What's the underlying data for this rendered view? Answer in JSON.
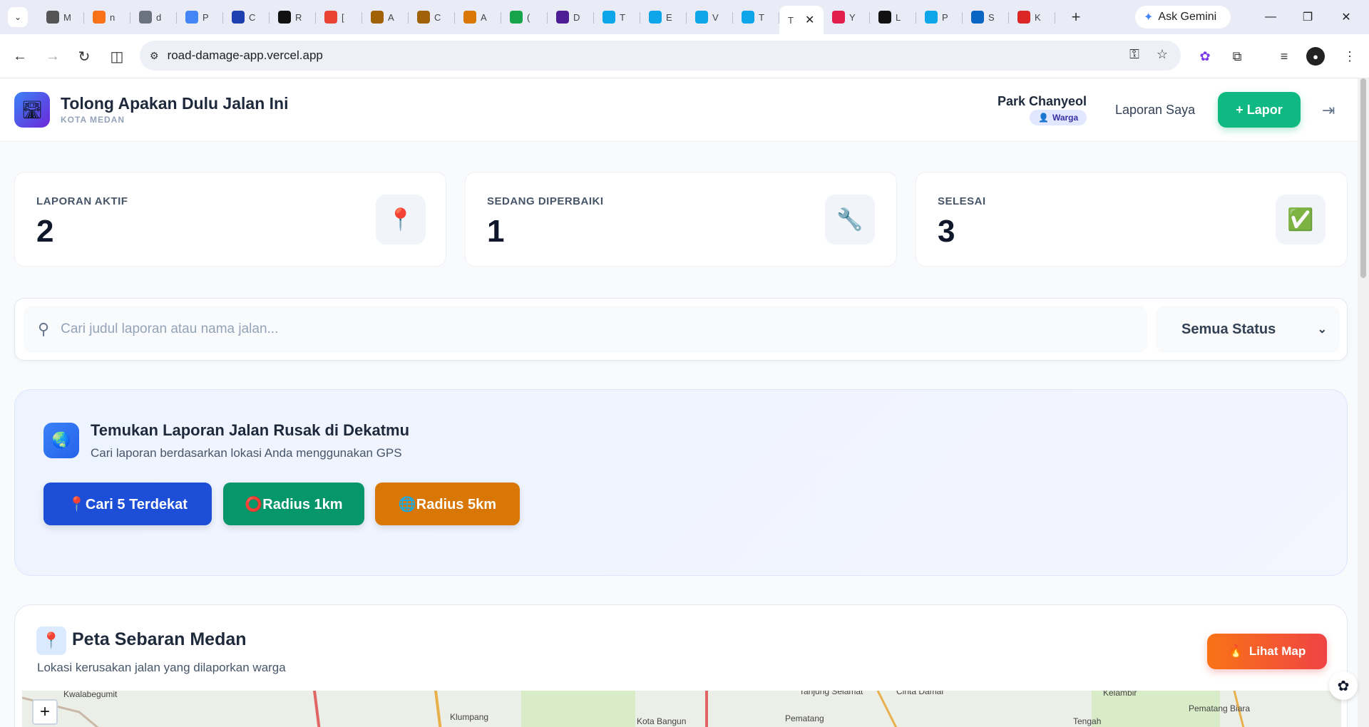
{
  "browser": {
    "tabs": [
      {
        "title": "M",
        "color": "#555"
      },
      {
        "title": "n",
        "color": "#f97316"
      },
      {
        "title": "d",
        "color": "#6b7280"
      },
      {
        "title": "P",
        "color": "#4285f4"
      },
      {
        "title": "C",
        "color": "#1e40af"
      },
      {
        "title": "R",
        "color": "#111"
      },
      {
        "title": "[",
        "color": "#ea4335"
      },
      {
        "title": "A",
        "color": "#a16207"
      },
      {
        "title": "C",
        "color": "#a16207"
      },
      {
        "title": "A",
        "color": "#d97706"
      },
      {
        "title": "(",
        "color": "#16a34a"
      },
      {
        "title": "D",
        "color": "#4c1d95"
      },
      {
        "title": "T",
        "color": "#0ea5e9"
      },
      {
        "title": "E",
        "color": "#0ea5e9"
      },
      {
        "title": "V",
        "color": "#0ea5e9"
      },
      {
        "title": "T",
        "color": "#0ea5e9"
      }
    ],
    "active_tab": {
      "title": "T"
    },
    "tabs_after": [
      {
        "title": "Y",
        "color": "#e11d48"
      },
      {
        "title": "L",
        "color": "#111"
      },
      {
        "title": "P",
        "color": "#0ea5e9"
      },
      {
        "title": "S",
        "color": "#0a66c2"
      },
      {
        "title": "K",
        "color": "#dc2626"
      }
    ],
    "ask_gemini": "Ask Gemini",
    "url": "road-damage-app.vercel.app"
  },
  "header": {
    "app_title": "Tolong Apakan Dulu Jalan Ini",
    "city": "KOTA MEDAN",
    "user_name": "Park Chanyeol",
    "user_role": "Warga",
    "my_reports": "Laporan Saya",
    "lapor_button": "+ Lapor"
  },
  "stats": [
    {
      "label": "LAPORAN AKTIF",
      "value": "2",
      "icon": "📍"
    },
    {
      "label": "SEDANG DIPERBAIKI",
      "value": "1",
      "icon": "🔧"
    },
    {
      "label": "SELESAI",
      "value": "3",
      "icon": "✅"
    }
  ],
  "search": {
    "placeholder": "Cari judul laporan atau nama jalan...",
    "status_selected": "Semua Status"
  },
  "nearby": {
    "title": "Temukan Laporan Jalan Rusak di Dekatmu",
    "subtitle": "Cari laporan berdasarkan lokasi Anda menggunakan GPS",
    "buttons": [
      {
        "label": "📍Cari 5 Terdekat",
        "color": "#1d4ed8"
      },
      {
        "label": "⭕Radius 1km",
        "color": "#059669"
      },
      {
        "label": "🌐Radius 5km",
        "color": "#d97706"
      }
    ]
  },
  "map": {
    "title": "Peta Sebaran Medan",
    "subtitle": "Lokasi kerusakan jalan yang dilaporkan warga",
    "lihat_button": "Lihat Map",
    "labels": [
      "Kwalabegumit",
      "Klumpang",
      "Kota Bangun",
      "Pematang",
      "Tanjung Selamat",
      "Cinta Damai",
      "Kelambir",
      "Pematang Biara",
      "Tengah"
    ]
  }
}
